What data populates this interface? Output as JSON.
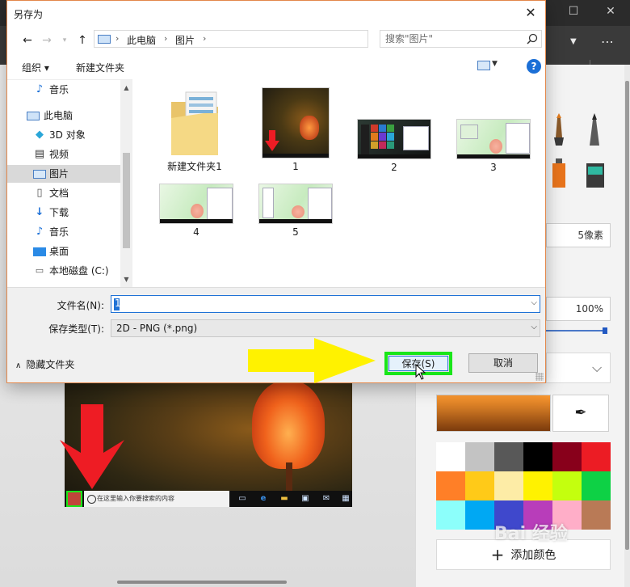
{
  "dialog": {
    "title": "另存为",
    "close_glyph": "✕",
    "address": {
      "crumbs": [
        "此电脑",
        "图片"
      ],
      "sep": "›"
    },
    "search": {
      "placeholder": "搜索\"图片\""
    },
    "toolbar": {
      "organize": "组织 ▾",
      "new_folder": "新建文件夹"
    },
    "help": "?",
    "nav_items": [
      {
        "label": "音乐",
        "icon": "music-note-icon"
      },
      {
        "label": "此电脑",
        "icon": "computer-icon"
      },
      {
        "label": "3D 对象",
        "icon": "3d-objects-icon"
      },
      {
        "label": "视频",
        "icon": "video-icon"
      },
      {
        "label": "图片",
        "icon": "pictures-icon",
        "selected": true
      },
      {
        "label": "文档",
        "icon": "documents-icon"
      },
      {
        "label": "下载",
        "icon": "download-icon"
      },
      {
        "label": "音乐",
        "icon": "music-note-icon"
      },
      {
        "label": "桌面",
        "icon": "desktop-icon"
      },
      {
        "label": "本地磁盘 (C:)",
        "icon": "local-disk-icon"
      }
    ],
    "files": [
      {
        "name": "新建文件夹1",
        "kind": "folder"
      },
      {
        "name": "1",
        "kind": "dark-photo"
      },
      {
        "name": "2",
        "kind": "dark-desktop"
      },
      {
        "name": "3",
        "kind": "green-desktop"
      },
      {
        "name": "4",
        "kind": "green-desktop"
      },
      {
        "name": "5",
        "kind": "green-desktop"
      }
    ],
    "filename_label": "文件名(N):",
    "filename_value": "1",
    "filetype_label": "保存类型(T):",
    "filetype_value": "2D - PNG (*.png)",
    "hide_folders": "隐藏文件夹",
    "save_label": "保存(S)",
    "cancel_label": "取消"
  },
  "background": {
    "size_value": "5像素",
    "opacity_value": "100%",
    "add_color": "添加颜色",
    "watermark": "Bai 经验",
    "photo_search_text": "在这里输入你要搜索的内容",
    "palette": [
      "#ffffff",
      "#c3c3c3",
      "#585858",
      "#000000",
      "#88001b",
      "#ec1c24",
      "#ff7f27",
      "#ffca18",
      "#fdeca6",
      "#fff200",
      "#c4ff0e",
      "#0ed145",
      "#8cfffb",
      "#00a8f3",
      "#3f48cc",
      "#b83dba",
      "#ffaec8",
      "#b97a56"
    ],
    "colors": {
      "highlight_green": "#19e619",
      "arrow_yellow": "#fff200",
      "arrow_red": "#ee1c24",
      "accent_blue": "#1f72d6"
    }
  }
}
